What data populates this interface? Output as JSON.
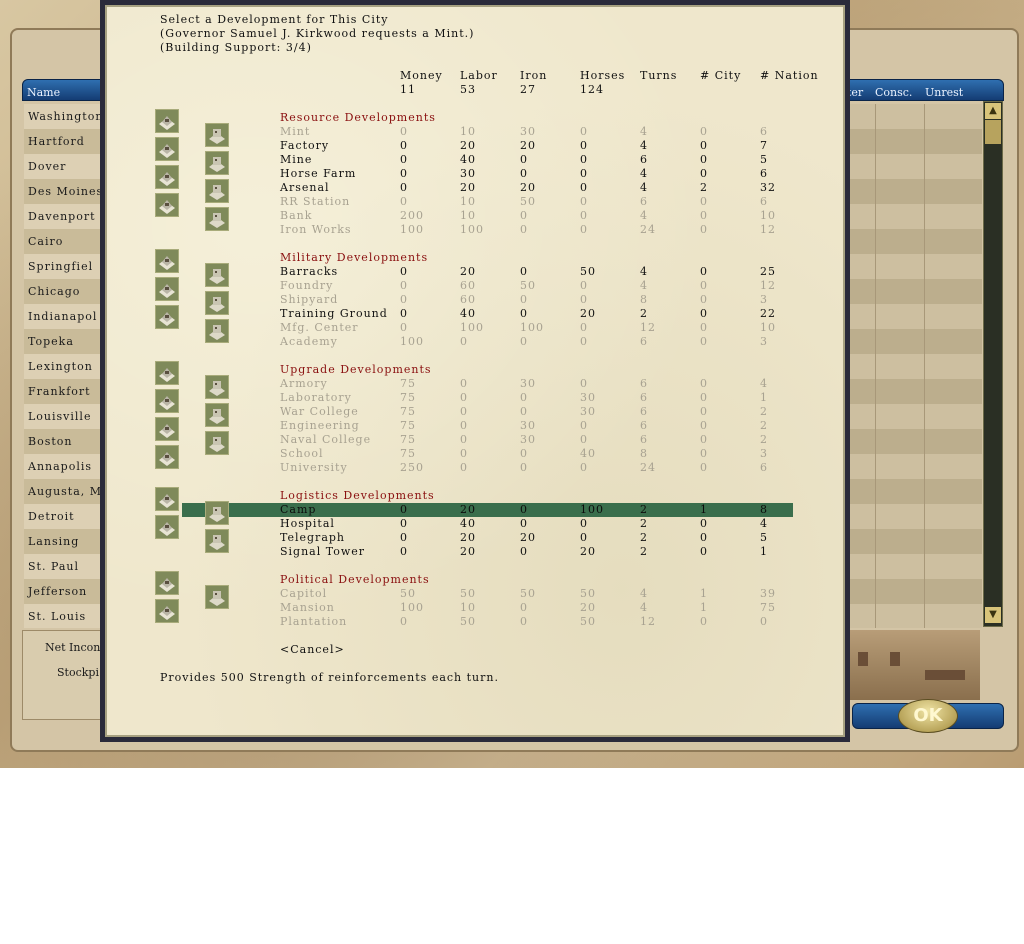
{
  "background": {
    "header_columns": [
      "Name",
      "ter",
      "Consc.",
      "Unrest"
    ],
    "cities": [
      "Washington",
      "Hartford",
      "Dover",
      "Des Moines",
      "Davenport",
      "Cairo",
      "Springfiel",
      "Chicago",
      "Indianapol",
      "Topeka",
      "Lexington",
      "Frankfort",
      "Louisville",
      "Boston",
      "Annapolis",
      "Augusta, M",
      "Detroit",
      "Lansing",
      "St. Paul",
      "Jefferson",
      "St. Louis"
    ],
    "net_income_label": "Net Incon",
    "stockpile_label": "Stockpi",
    "ok_label": "OK",
    "scroll_up": "▲",
    "scroll_down": "▼"
  },
  "dialog": {
    "title_line1": "Select a Development for This City",
    "title_line2": "(Governor Samuel J. Kirkwood requests a Mint.)",
    "title_line3": "(Building Support: 3/4)",
    "columns": [
      "Money",
      "Labor",
      "Iron",
      "Horses",
      "Turns",
      "# City",
      "# Nation"
    ],
    "available": [
      "11",
      "53",
      "27",
      "124"
    ],
    "sections": [
      {
        "title": "Resource Developments",
        "rows": [
          {
            "name": "Mint",
            "vals": [
              "0",
              "10",
              "30",
              "0",
              "4",
              "0",
              "6"
            ],
            "available": false
          },
          {
            "name": "Factory",
            "vals": [
              "0",
              "20",
              "20",
              "0",
              "4",
              "0",
              "7"
            ],
            "available": true
          },
          {
            "name": "Mine",
            "vals": [
              "0",
              "40",
              "0",
              "0",
              "6",
              "0",
              "5"
            ],
            "available": true
          },
          {
            "name": "Horse Farm",
            "vals": [
              "0",
              "30",
              "0",
              "0",
              "4",
              "0",
              "6"
            ],
            "available": true
          },
          {
            "name": "Arsenal",
            "vals": [
              "0",
              "20",
              "20",
              "0",
              "4",
              "2",
              "32"
            ],
            "available": true
          },
          {
            "name": "RR Station",
            "vals": [
              "0",
              "10",
              "50",
              "0",
              "6",
              "0",
              "6"
            ],
            "available": false
          },
          {
            "name": "Bank",
            "vals": [
              "200",
              "10",
              "0",
              "0",
              "4",
              "0",
              "10"
            ],
            "available": false
          },
          {
            "name": "Iron Works",
            "vals": [
              "100",
              "100",
              "0",
              "0",
              "24",
              "0",
              "12"
            ],
            "available": false
          }
        ]
      },
      {
        "title": "Military Developments",
        "rows": [
          {
            "name": "Barracks",
            "vals": [
              "0",
              "20",
              "0",
              "50",
              "4",
              "0",
              "25"
            ],
            "available": true
          },
          {
            "name": "Foundry",
            "vals": [
              "0",
              "60",
              "50",
              "0",
              "4",
              "0",
              "12"
            ],
            "available": false
          },
          {
            "name": "Shipyard",
            "vals": [
              "0",
              "60",
              "0",
              "0",
              "8",
              "0",
              "3"
            ],
            "available": false
          },
          {
            "name": "Training Ground",
            "vals": [
              "0",
              "40",
              "0",
              "20",
              "2",
              "0",
              "22"
            ],
            "available": true
          },
          {
            "name": "Mfg. Center",
            "vals": [
              "0",
              "100",
              "100",
              "0",
              "12",
              "0",
              "10"
            ],
            "available": false
          },
          {
            "name": "Academy",
            "vals": [
              "100",
              "0",
              "0",
              "0",
              "6",
              "0",
              "3"
            ],
            "available": false
          }
        ]
      },
      {
        "title": "Upgrade Developments",
        "rows": [
          {
            "name": "Armory",
            "vals": [
              "75",
              "0",
              "30",
              "0",
              "6",
              "0",
              "4"
            ],
            "available": false
          },
          {
            "name": "Laboratory",
            "vals": [
              "75",
              "0",
              "0",
              "30",
              "6",
              "0",
              "1"
            ],
            "available": false
          },
          {
            "name": "War College",
            "vals": [
              "75",
              "0",
              "0",
              "30",
              "6",
              "0",
              "2"
            ],
            "available": false
          },
          {
            "name": "Engineering",
            "vals": [
              "75",
              "0",
              "30",
              "0",
              "6",
              "0",
              "2"
            ],
            "available": false
          },
          {
            "name": "Naval College",
            "vals": [
              "75",
              "0",
              "30",
              "0",
              "6",
              "0",
              "2"
            ],
            "available": false
          },
          {
            "name": "School",
            "vals": [
              "75",
              "0",
              "0",
              "40",
              "8",
              "0",
              "3"
            ],
            "available": false
          },
          {
            "name": "University",
            "vals": [
              "250",
              "0",
              "0",
              "0",
              "24",
              "0",
              "6"
            ],
            "available": false
          }
        ]
      },
      {
        "title": "Logistics Developments",
        "rows": [
          {
            "name": "Camp",
            "vals": [
              "0",
              "20",
              "0",
              "100",
              "2",
              "1",
              "8"
            ],
            "available": true,
            "selected": true
          },
          {
            "name": "Hospital",
            "vals": [
              "0",
              "40",
              "0",
              "0",
              "2",
              "0",
              "4"
            ],
            "available": true
          },
          {
            "name": "Telegraph",
            "vals": [
              "0",
              "20",
              "20",
              "0",
              "2",
              "0",
              "5"
            ],
            "available": true
          },
          {
            "name": "Signal Tower",
            "vals": [
              "0",
              "20",
              "0",
              "20",
              "2",
              "0",
              "1"
            ],
            "available": true
          }
        ]
      },
      {
        "title": "Political Developments",
        "rows": [
          {
            "name": "Capitol",
            "vals": [
              "50",
              "50",
              "50",
              "50",
              "4",
              "1",
              "39"
            ],
            "available": false
          },
          {
            "name": "Mansion",
            "vals": [
              "100",
              "10",
              "0",
              "20",
              "4",
              "1",
              "75"
            ],
            "available": false
          },
          {
            "name": "Plantation",
            "vals": [
              "0",
              "50",
              "0",
              "50",
              "12",
              "0",
              "0"
            ],
            "available": false
          }
        ]
      }
    ],
    "cancel_label": "<Cancel>",
    "description": "Provides 500 Strength of reinforcements each turn."
  }
}
